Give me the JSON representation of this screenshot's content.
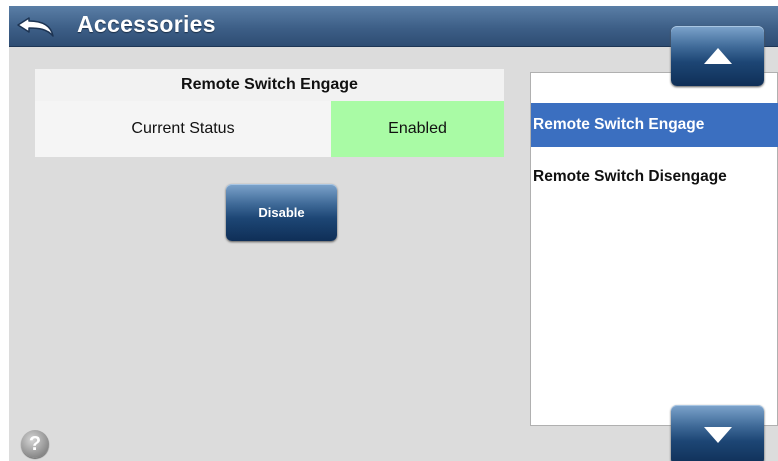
{
  "header": {
    "title": "Accessories",
    "back_icon": "back-arrow-icon"
  },
  "status": {
    "heading": "Remote Switch Engage",
    "label": "Current Status",
    "value": "Enabled",
    "value_color": "#a9fba5"
  },
  "actions": {
    "disable_label": "Disable"
  },
  "list": {
    "items": [
      {
        "label": "Remote Switch Engage",
        "selected": true
      },
      {
        "label": "Remote Switch Disengage",
        "selected": false
      }
    ],
    "selected_color": "#3b6fc0",
    "scroll_up_icon": "triangle-up-icon",
    "scroll_down_icon": "triangle-down-icon"
  },
  "help": {
    "icon": "help-icon",
    "glyph": "?"
  }
}
